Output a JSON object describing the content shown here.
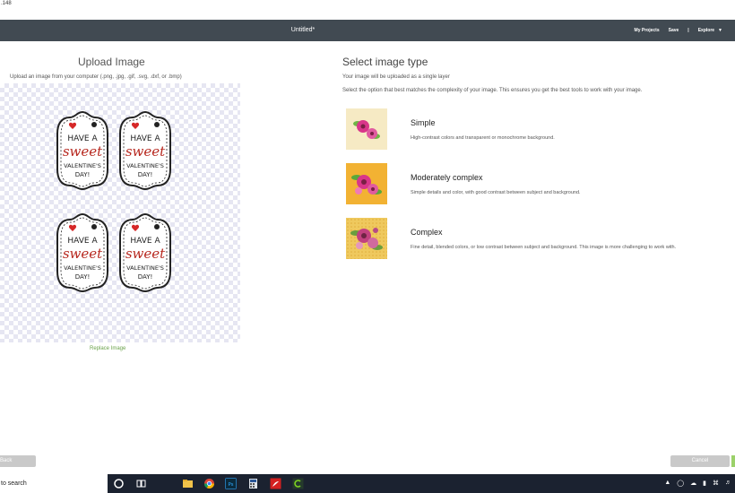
{
  "window": {
    "title_fragment": ".148"
  },
  "app_bar": {
    "document_title": "Untitled*",
    "nav": {
      "my_projects": "My Projects",
      "save": "Save",
      "separator": "|",
      "explore": "Explore"
    }
  },
  "upload_panel": {
    "title": "Upload Image",
    "instructions": "Upload an image from your computer (.png, .jpg, .gif, .svg, .dxf, or .bmp)",
    "preview_tags": [
      {
        "line1": "HAVE A",
        "line2": "sweet",
        "line3": "VALENTINE'S",
        "line4": "DAY!"
      },
      {
        "line1": "HAVE A",
        "line2": "sweet",
        "line3": "VALENTINE'S",
        "line4": "DAY!"
      },
      {
        "line1": "HAVE A",
        "line2": "sweet",
        "line3": "VALENTINE'S",
        "line4": "DAY!"
      },
      {
        "line1": "HAVE A",
        "line2": "sweet",
        "line3": "VALENTINE'S",
        "line4": "DAY!"
      }
    ],
    "replace_link": "Replace Image"
  },
  "type_panel": {
    "title": "Select image type",
    "subtitle1": "Your image will be uploaded as a single layer",
    "subtitle2": "Select the option that best matches the complexity of your image. This ensures you get the best tools to work with your image.",
    "options": [
      {
        "title": "Simple",
        "description": "High-contrast colors and transparent or monochrome background.",
        "thumb_color": "#f6eac4"
      },
      {
        "title": "Moderately complex",
        "description": "Simple details and color, with good contrast between subject and background.",
        "thumb_color": "#f2b233"
      },
      {
        "title": "Complex",
        "description": "Fine detail, blended colors, or low contrast between subject and background. This image is more challenging to work with.",
        "thumb_color": "#efc95e"
      }
    ]
  },
  "footer": {
    "back": "Back",
    "cancel": "Cancel"
  },
  "taskbar": {
    "search": "to search"
  },
  "colors": {
    "app_bar": "#414a52",
    "link_green": "#6aa24a",
    "heart_red": "#d62828"
  }
}
